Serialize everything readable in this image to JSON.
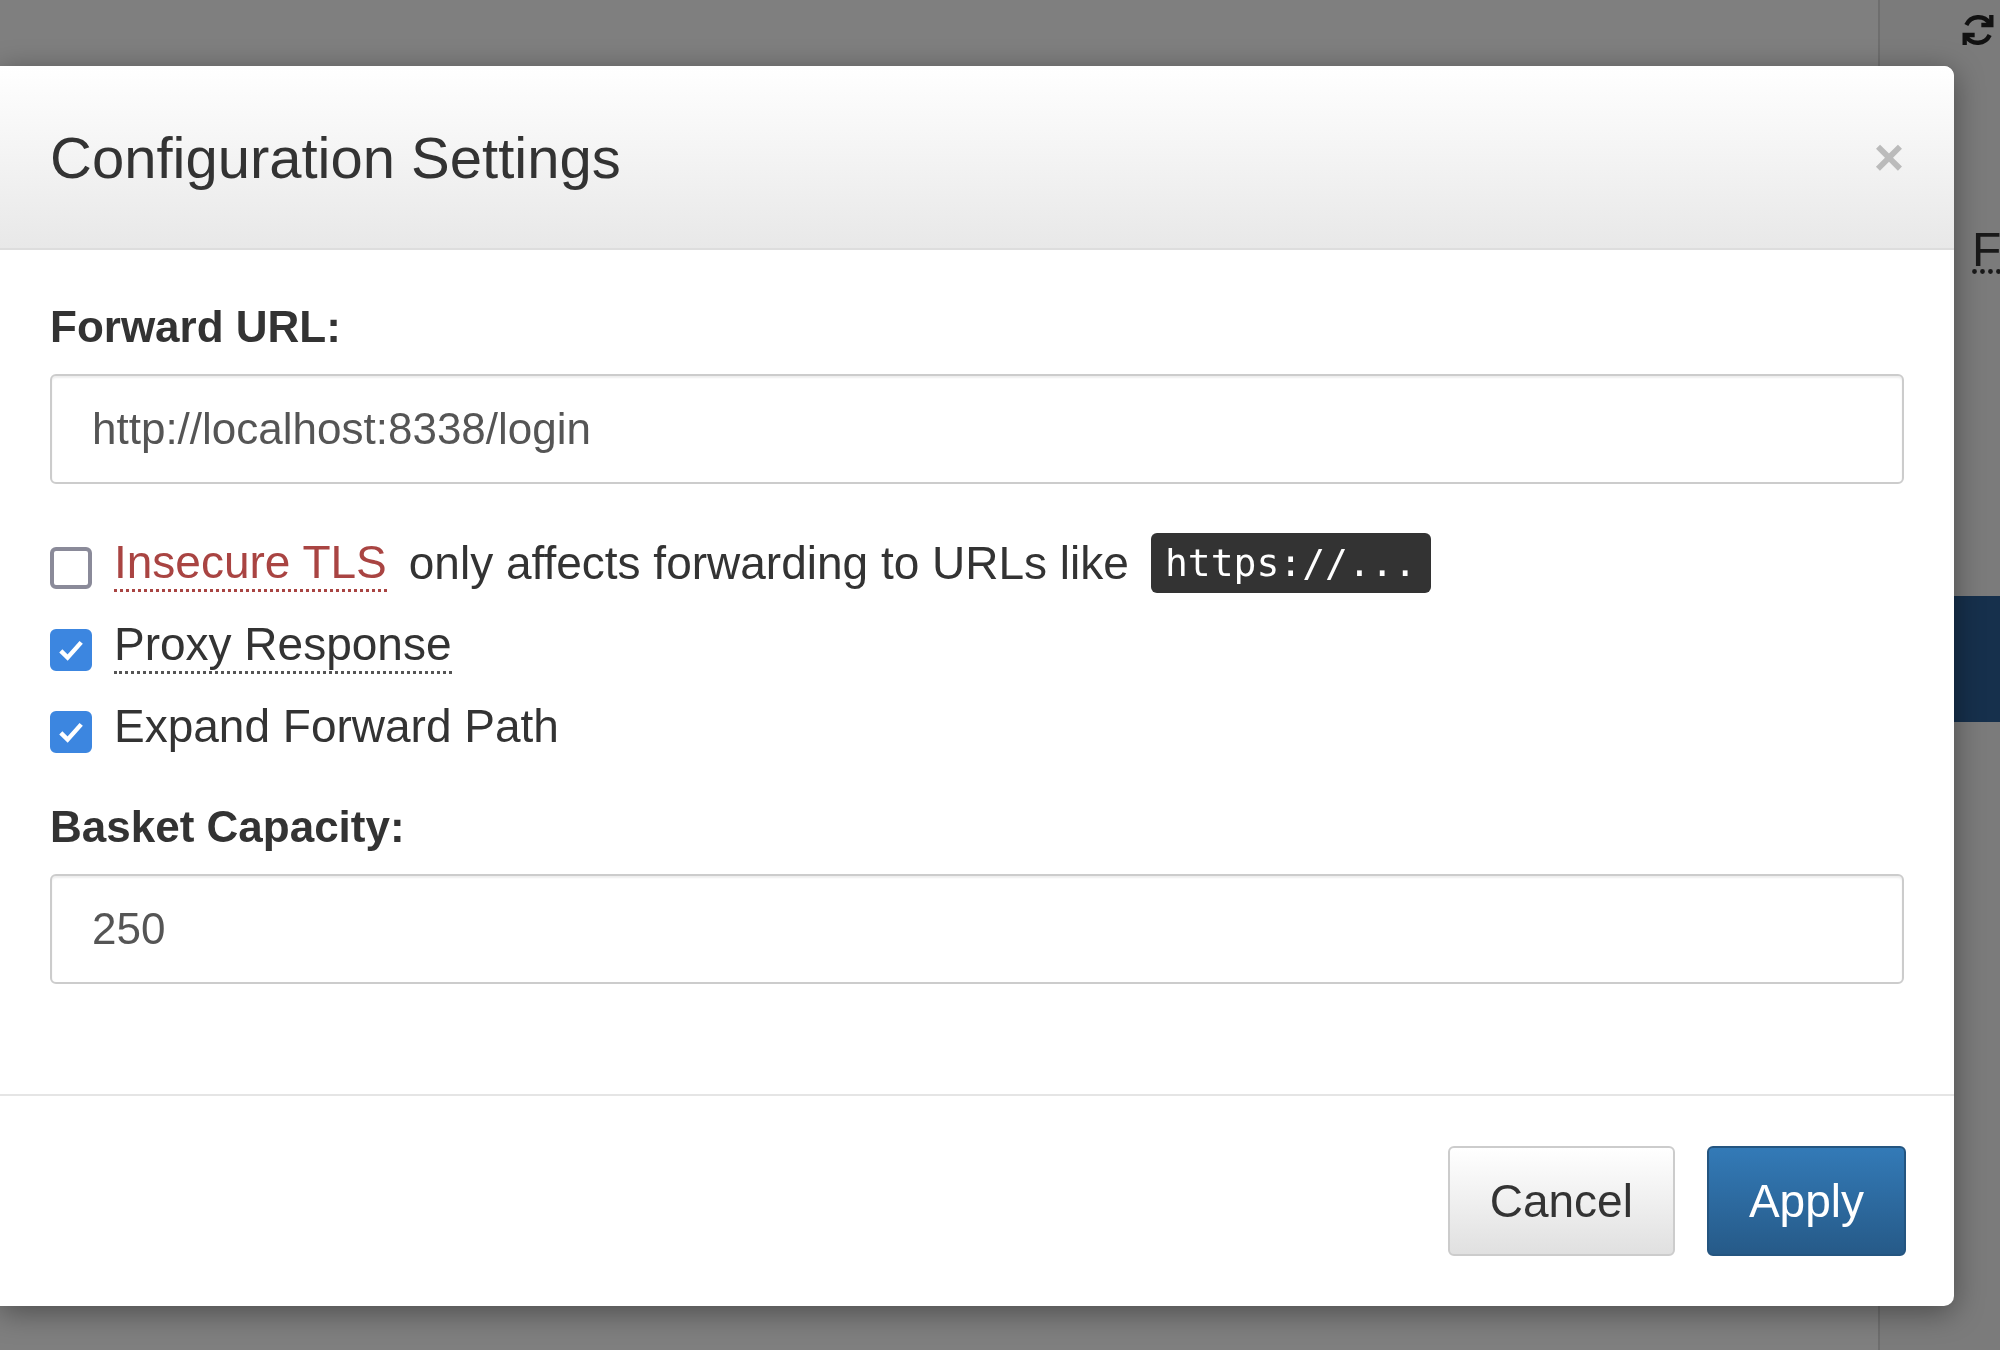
{
  "background": {
    "partial_text": "F"
  },
  "dialog": {
    "title": "Configuration Settings",
    "close": "×",
    "forward_url": {
      "label": "Forward URL:",
      "value": "http://localhost:8338/login"
    },
    "options": [
      {
        "kind": "warning",
        "label": "Insecure TLS",
        "note": "only affects forwarding to URLs like",
        "code": "https://...",
        "checked": false
      },
      {
        "kind": "help",
        "label": "Proxy Response",
        "checked": true
      },
      {
        "kind": "plain",
        "label": "Expand Forward Path",
        "checked": true
      }
    ],
    "capacity": {
      "label": "Basket Capacity:",
      "value": "250"
    },
    "buttons": [
      {
        "kind": "default",
        "label": "Cancel"
      },
      {
        "kind": "primary",
        "label": "Apply"
      }
    ]
  }
}
